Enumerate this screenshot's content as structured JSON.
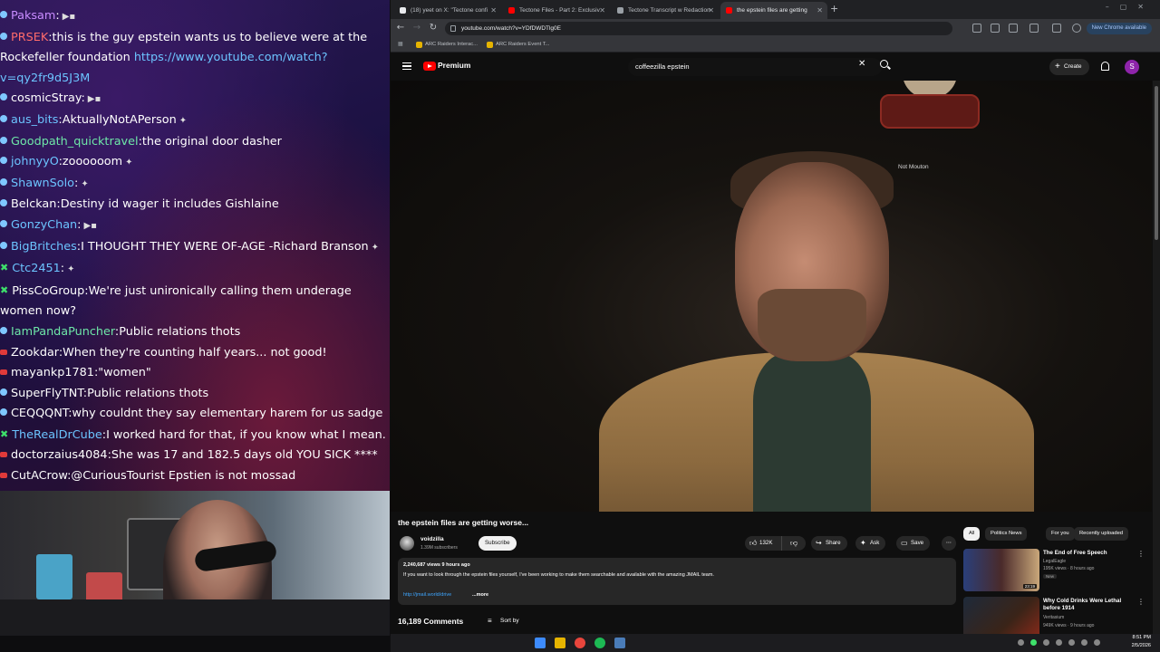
{
  "chat": {
    "messages": [
      {
        "user": "Paksam",
        "color": "#c88cff",
        "badge": "sub",
        "text": "",
        "emote": "▶▪"
      },
      {
        "user": "PRSEK",
        "color": "#ff6b6b",
        "badge": "sub",
        "text": "this is the guy epstein wants us to believe were at the Rockefeller foundation",
        "link": "https://www.youtube.com/watch?v=qy2fr9d5J3M"
      },
      {
        "user": "cosmicStray",
        "color": "#ffffff",
        "badge": "sub",
        "text": "",
        "emote": "▶▪"
      },
      {
        "user": "aus_bits",
        "color": "#6cc4ff",
        "badge": "sub",
        "text": "AktuallyNotAPerson",
        "emote": "✦"
      },
      {
        "user": "Goodpath_quicktravel",
        "color": "#6ee7a8",
        "badge": "sub",
        "text": "the original door dasher"
      },
      {
        "user": "johnyyO",
        "color": "#6cc4ff",
        "badge": "sub",
        "text": "zoooooom",
        "emote": "✦"
      },
      {
        "user": "ShawnSolo",
        "color": "#6cc4ff",
        "badge": "sub",
        "text": "",
        "emote": "✦"
      },
      {
        "user": "Belckan",
        "color": "#ffffff",
        "badge": "sub",
        "text": "Destiny id wager it includes Gishlaine"
      },
      {
        "user": "GonzyChan",
        "color": "#6cc4ff",
        "badge": "sub",
        "text": "",
        "emote": "▶▪"
      },
      {
        "user": "BigBritches",
        "color": "#6cc4ff",
        "badge": "sub",
        "text": "I THOUGHT THEY WERE OF-AGE -Richard Branson",
        "emote": "✦"
      },
      {
        "user": "Ctc2451",
        "color": "#6cc4ff",
        "badge": "x",
        "text": "",
        "emote": "✦"
      },
      {
        "user": "PissCoGroup",
        "color": "#ffffff",
        "badge": "x",
        "text": "We're just unironically calling them underage women now?"
      },
      {
        "user": "IamPandaPuncher",
        "color": "#6ee7a8",
        "badge": "sub",
        "text": "Public relations thots"
      },
      {
        "user": "Zookdar",
        "color": "#ffffff",
        "badge": "red",
        "text": "When they're counting half years... not good!"
      },
      {
        "user": "mayankp1781",
        "color": "#ffffff",
        "badge": "red",
        "text": "\"women\""
      },
      {
        "user": "SuperFlyTNT",
        "color": "#ffffff",
        "badge": "sub",
        "text": "Public relations thots"
      },
      {
        "user": "CEQQQNT",
        "color": "#ffffff",
        "badge": "sub",
        "text": "why couldnt they say elementary harem for us sadge"
      },
      {
        "user": "TheRealDrCube",
        "color": "#6cc4ff",
        "badge": "x",
        "text": "I worked hard for that, if you know what I mean."
      },
      {
        "user": "doctorzaius4084",
        "color": "#ffffff",
        "badge": "red",
        "text": "She was 17 and 182.5 days old YOU SICK ****"
      },
      {
        "user": "CutACrow",
        "color": "#ffffff",
        "badge": "red",
        "text": "@CuriousTourist Epstien is not mossad"
      }
    ]
  },
  "browser": {
    "tabs": [
      {
        "label": "(18) yeet on X: \"Tectone confi",
        "fav": "#e8eaed"
      },
      {
        "label": "Tectone Files - Part 2: Exclusiv",
        "fav": "#ff0000"
      },
      {
        "label": "Tectone Transcript w Redaction",
        "fav": "#9aa0a6"
      },
      {
        "label": "the epstein files are getting",
        "fav": "#ff0000"
      }
    ],
    "url": "youtube.com/watch?v=YDfDWDTlg0E",
    "update_label": "New Chrome available",
    "bookmarks": [
      "ARC Raiders Interac...",
      "ARC Raiders Event T..."
    ]
  },
  "youtube": {
    "brand": "Premium",
    "search_query": "coffeezilla epstein",
    "create_label": "Create",
    "avatar_letter": "S",
    "overlay_name": "Not Mouton",
    "video_title": "the epstein files are getting worse...",
    "channel": {
      "name": "voidzilla",
      "subs": "1.39M subscribers"
    },
    "subscribe_label": "Subscribe",
    "actions": {
      "likes": "132K",
      "share": "Share",
      "ask": "Ask",
      "save": "Save"
    },
    "description": {
      "meta": "2,240,687 views  9 hours ago",
      "text": "If you want to look through the epstein files yourself, I've been working to make them searchable and available with the amazing JMAIL team.",
      "link": "http://jmail.world/drive",
      "more": "...more"
    },
    "comments_count": "16,189 Comments",
    "sort_label": "Sort by",
    "chips": [
      "All",
      "Politics News",
      "For you",
      "Recently uploaded"
    ],
    "recommendations": [
      {
        "title": "The End of Free Speech",
        "channel": "LegalEagle",
        "meta": "195K views · 8 hours ago",
        "badge": "New",
        "duration": "23:19"
      },
      {
        "title": "Why Cold Drinks Were Lethal before 1914",
        "channel": "Veritasium",
        "meta": "949K views · 9 hours ago",
        "badge": "",
        "duration": ""
      }
    ]
  },
  "taskbar": {
    "time": "8:51 PM",
    "date": "2/5/2026"
  }
}
